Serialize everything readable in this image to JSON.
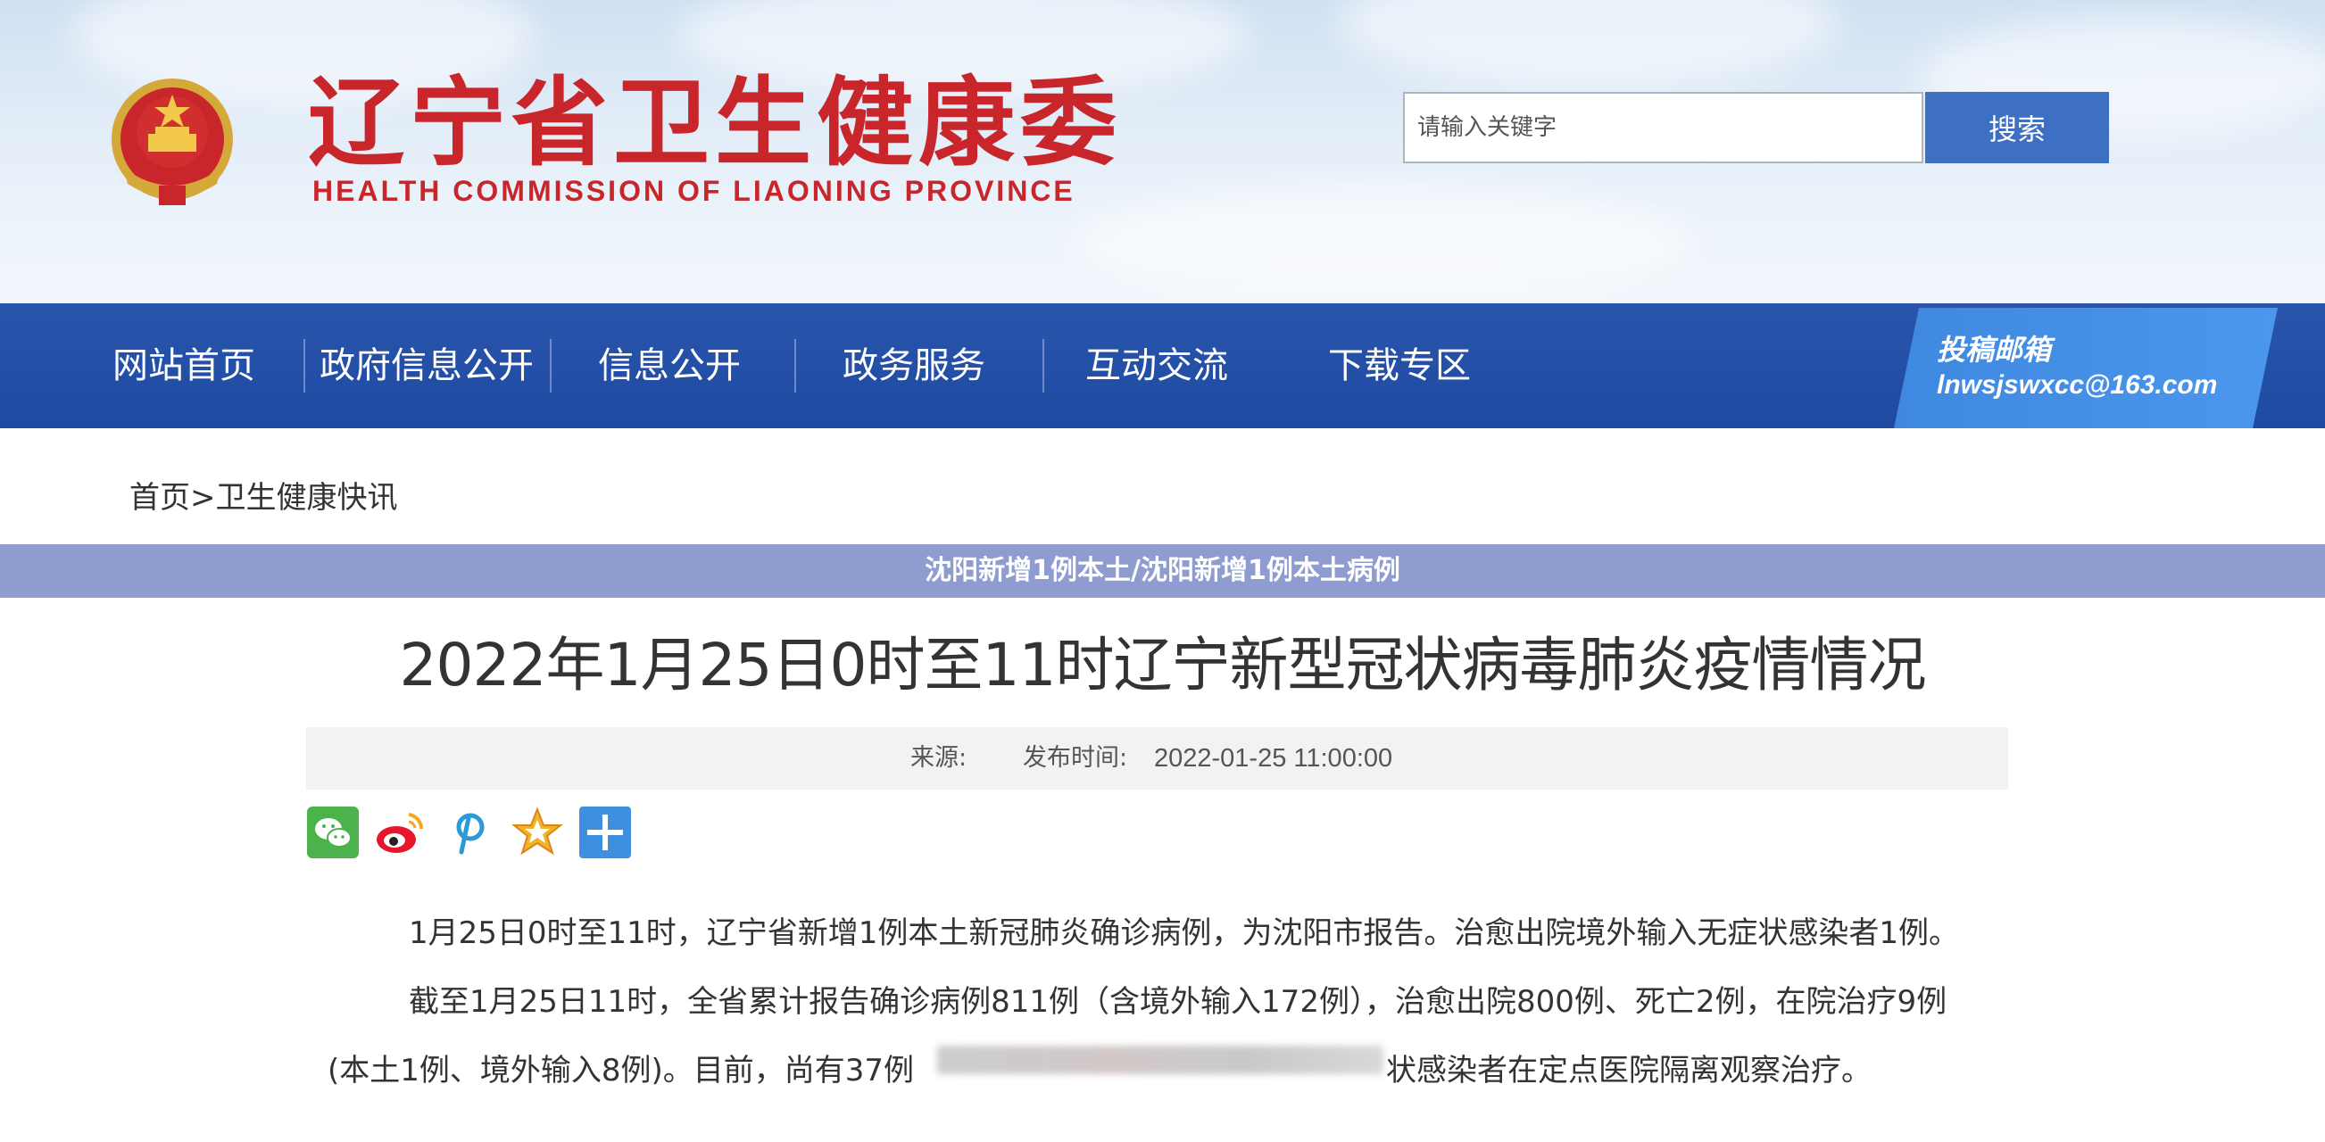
{
  "header": {
    "site_title": "辽宁省卫生健康委",
    "site_subtitle": "HEALTH COMMISSION OF LIAONING PROVINCE",
    "search": {
      "placeholder": "请输入关键字",
      "button_label": "搜索"
    }
  },
  "nav": {
    "items": [
      {
        "label": "网站首页"
      },
      {
        "label": "政府信息公开"
      },
      {
        "label": "信息公开"
      },
      {
        "label": "政务服务"
      },
      {
        "label": "互动交流"
      },
      {
        "label": "下载专区"
      }
    ],
    "email": {
      "label": "投稿邮箱",
      "value": "lnwsjswxcc@163.com"
    }
  },
  "breadcrumb": {
    "home": "首页",
    "separator": ">",
    "section": "卫生健康快讯"
  },
  "overlay_banner": "沈阳新增1例本土/沈阳新增1例本土病例",
  "article": {
    "title": "2022年1月25日0时至11时辽宁新型冠状病毒肺炎疫情情况",
    "meta": {
      "source_label": "来源:",
      "time_label": "发布时间:",
      "time_value": "2022-01-25 11:00:00"
    },
    "share_icons": [
      "wechat-icon",
      "weibo-icon",
      "pinterest-icon",
      "favorite-star-icon",
      "add-plus-icon"
    ],
    "paragraphs": {
      "p1": "1月25日0时至11时，辽宁省新增1例本土新冠肺炎确诊病例，为沈阳市报告。治愈出院境外输入无症状感染者1例。",
      "p2_line1": "截至1月25日11时，全省累计报告确诊病例811例（含境外输入172例），治愈出院800例、死亡2例，在院治疗9例",
      "p2_line2_start": "(本土1例、境外输入8例)。目前，尚有37例",
      "p2_line2_end": "状感染者在定点医院隔离观察治疗。"
    }
  },
  "colors": {
    "brand_red": "#c8262b",
    "nav_blue": "#2350a8",
    "search_button_blue": "#3d6fc2",
    "email_blue": "#4690e8",
    "banner_purple": "#8e9ccf"
  }
}
